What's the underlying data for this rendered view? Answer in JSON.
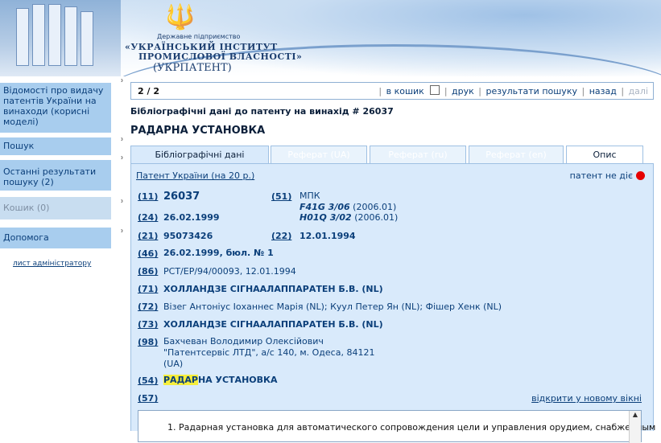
{
  "header": {
    "logo_small": "Державне підприємство",
    "logo_line1": "«УКРАЇНСЬКИЙ ІНСТИТУТ",
    "logo_line2": "ПРОМИСЛОВОЇ ВЛАСНОСТІ»",
    "logo_line3": "(УКРПАТЕНТ)",
    "emblem_icon": "trident-icon"
  },
  "sidebar": {
    "items": [
      {
        "label": "Відомості про видачу патентів України на винаходи (корисні моделі)"
      },
      {
        "label": "Пошук"
      },
      {
        "label": "Останні результати пошуку (2)"
      },
      {
        "label": "Кошик (0)"
      },
      {
        "label": "Допомога"
      }
    ],
    "admin_link": "лист адміністратору"
  },
  "toolbar": {
    "page_counter": "2 / 2",
    "to_cart": "в кошик",
    "print": "друк",
    "search_results": "результати пошуку",
    "back": "назад",
    "next": "далі"
  },
  "document": {
    "heading": "Бібліографічні дані до патенту на винахід # 26037",
    "title": "РАДАРНА УСТАНОВКА"
  },
  "tabs": [
    {
      "label": "Бібліографічні дані"
    },
    {
      "label": "Реферат (UA)"
    },
    {
      "label": "Реферат (ru)"
    },
    {
      "label": "Реферат (en)"
    },
    {
      "label": "Опис"
    }
  ],
  "content": {
    "patent_type": "Патент України (на 20 р.)",
    "status": "патент не діє",
    "status_color": "#e60000",
    "f11": {
      "code": "(11)",
      "value": "26037"
    },
    "f51": {
      "code": "(51)",
      "label": "МПК",
      "line1_code": "F41G 3/06",
      "line1_date": "(2006.01)",
      "line2_code": "H01Q 3/02",
      "line2_date": "(2006.01)"
    },
    "f24": {
      "code": "(24)",
      "value": "26.02.1999"
    },
    "f21": {
      "code": "(21)",
      "value": "95073426"
    },
    "f22": {
      "code": "(22)",
      "value": "12.01.1994"
    },
    "f46": {
      "code": "(46)",
      "value": "26.02.1999, бюл. № 1"
    },
    "f86": {
      "code": "(86)",
      "value": "PCT/EP/94/00093, 12.01.1994"
    },
    "f71": {
      "code": "(71)",
      "value": "ХОЛЛАНДЗЕ СІГНААЛАППАРАТЕН Б.В. (NL)"
    },
    "f72": {
      "code": "(72)",
      "value": "Візег Антоніус Іоханнес Марія (NL); Куул Петер Ян (NL); Фішер Хенк (NL)"
    },
    "f73": {
      "code": "(73)",
      "value": "ХОЛЛАНДЗЕ СІГНААЛАППАРАТЕН Б.В. (NL)"
    },
    "f98": {
      "code": "(98)",
      "line1": "Бахчеван Володимир Олексійович",
      "line2": "\"Патентсервіс ЛТД\", а/с 140, м. Одеса, 84121",
      "line3": "(UA)"
    },
    "f54": {
      "code": "(54)",
      "highlight": "РАДАР",
      "rest": "НА УСТАНОВКА"
    },
    "f57": {
      "code": "(57)",
      "open_new_window": "відкрити у новому вікні"
    },
    "claims_text": "1. Радарная установка для автоматического сопровождения цели и управления орудием, снабженным"
  }
}
